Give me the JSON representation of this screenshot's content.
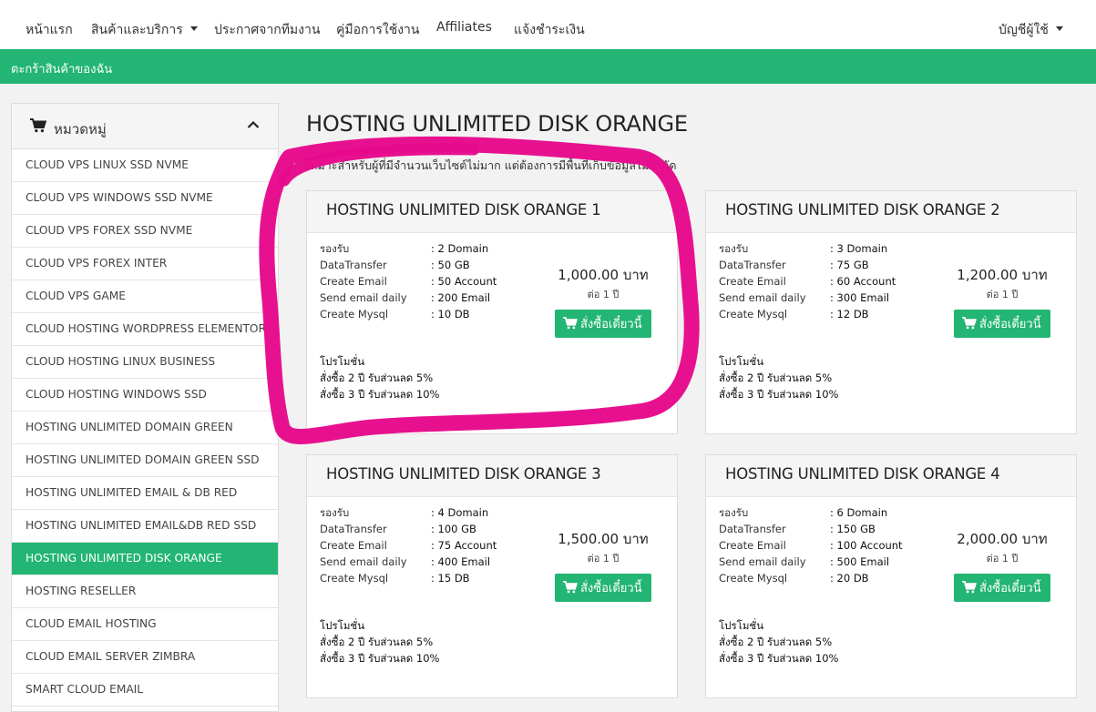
{
  "nav": {
    "items": [
      "หน้าแรก",
      "สินค้าและบริการ",
      "ประกาศจากทีมงาน",
      "คู่มือการใช้งาน",
      "Affiliates",
      "แจ้งชำระเงิน"
    ],
    "account": "บัญชีผู้ใช้"
  },
  "banner": {
    "title": "ตะกร้าสินค้าของฉัน"
  },
  "sidebar": {
    "title": "หมวดหมู่",
    "items": [
      "CLOUD VPS LINUX SSD NVME",
      "CLOUD VPS WINDOWS SSD NVME",
      "CLOUD VPS FOREX SSD NVME",
      "CLOUD VPS FOREX INTER",
      "CLOUD VPS GAME",
      "CLOUD HOSTING WORDPRESS ELEMENTOR",
      "CLOUD HOSTING LINUX BUSINESS",
      "CLOUD HOSTING WINDOWS SSD",
      "HOSTING UNLIMITED DOMAIN GREEN",
      "HOSTING UNLIMITED DOMAIN GREEN SSD",
      "HOSTING UNLIMITED EMAIL & DB RED",
      "HOSTING UNLIMITED EMAIL&DB RED SSD",
      "HOSTING UNLIMITED DISK ORANGE",
      "HOSTING RESELLER",
      "CLOUD EMAIL HOSTING",
      "CLOUD EMAIL SERVER ZIMBRA",
      "SMART CLOUD EMAIL"
    ],
    "active_index": 12
  },
  "main": {
    "title": "HOSTING UNLIMITED DISK ORANGE",
    "description": "เหมาะสำหรับผู้ที่มีจำนวนเว็บไซต์ไม่มาก แต่ต้องการมีพื้นที่เก็บข้อมูลไม่จำกัด",
    "spec_labels": [
      "รองรับ",
      "DataTransfer",
      "Create Email",
      "Send email daily",
      "Create Mysql"
    ],
    "per_label": "ต่อ 1 ปี",
    "buy_label": "สั่งซื้อเดี๋ยวนี้",
    "promo": [
      "โปรโมชั่น",
      "สั่งซื้อ 2 ปี รับส่วนลด 5%",
      "สั่งซื้อ 3 ปี รับส่วนลด 10%"
    ],
    "plans": [
      {
        "name": "HOSTING UNLIMITED DISK ORANGE 1",
        "values": [
          ": 2 Domain",
          ": 50 GB",
          ": 50 Account",
          ": 200 Email",
          ": 10 DB"
        ],
        "price": "1,000.00 บาท"
      },
      {
        "name": "HOSTING UNLIMITED DISK ORANGE 2",
        "values": [
          ": 3 Domain",
          ": 75 GB",
          ": 60 Account",
          ": 300 Email",
          ": 12 DB"
        ],
        "price": "1,200.00 บาท"
      },
      {
        "name": "HOSTING UNLIMITED DISK ORANGE 3",
        "values": [
          ": 4 Domain",
          ": 100 GB",
          ": 75 Account",
          ": 400 Email",
          ": 15 DB"
        ],
        "price": "1,500.00 บาท"
      },
      {
        "name": "HOSTING UNLIMITED DISK ORANGE 4",
        "values": [
          ": 6 Domain",
          ": 150 GB",
          ": 100 Account",
          ": 500 Email",
          ": 20 DB"
        ],
        "price": "2,000.00 บาท"
      }
    ]
  },
  "colors": {
    "accent": "#22b573",
    "highlight": "#e6098b"
  },
  "icons": {
    "cart": "cart-icon",
    "collapse": "chevron-up-icon",
    "dropdown": "caret-down-icon"
  }
}
